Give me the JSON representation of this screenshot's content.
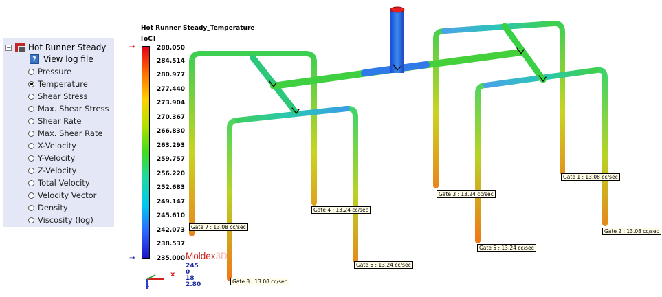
{
  "tree": {
    "root_label": "Hot Runner Steady",
    "log_label": "View log file",
    "options": [
      {
        "label": "Pressure",
        "selected": false
      },
      {
        "label": "Temperature",
        "selected": true
      },
      {
        "label": "Shear Stress",
        "selected": false
      },
      {
        "label": "Max. Shear Stress",
        "selected": false
      },
      {
        "label": "Shear Rate",
        "selected": false
      },
      {
        "label": "Max. Shear Rate",
        "selected": false
      },
      {
        "label": "X-Velocity",
        "selected": false
      },
      {
        "label": "Y-Velocity",
        "selected": false
      },
      {
        "label": "Z-Velocity",
        "selected": false
      },
      {
        "label": "Total Velocity",
        "selected": false
      },
      {
        "label": "Velocity Vector",
        "selected": false
      },
      {
        "label": "Density",
        "selected": false
      },
      {
        "label": "Viscosity (log)",
        "selected": false
      }
    ]
  },
  "legend": {
    "title": "Hot Runner Steady_Temperature",
    "unit": "[oC]",
    "ticks": [
      "288.050",
      "284.514",
      "280.977",
      "277.440",
      "273.904",
      "270.367",
      "266.830",
      "263.293",
      "259.757",
      "256.220",
      "252.683",
      "249.147",
      "245.610",
      "242.073",
      "238.537",
      "235.000"
    ],
    "colors": [
      "#e4001b",
      "#ff6a00",
      "#ffd000",
      "#b5e000",
      "#3fdc1e",
      "#20d8a2",
      "#00c8ee",
      "#2e63ff",
      "#1d14cc"
    ]
  },
  "brand": {
    "name": "Moldex",
    "suffix": "3D"
  },
  "view_info": [
    "245",
    "0",
    "18",
    "2.80"
  ],
  "axes": {
    "x": "x",
    "z": "z"
  },
  "gates": [
    {
      "label": "Gate 1 : 13.08 cc/sec"
    },
    {
      "label": "Gate 2 : 13.08 cc/sec"
    },
    {
      "label": "Gate 3 : 13.24 cc/sec"
    },
    {
      "label": "Gate 4 : 13.24 cc/sec"
    },
    {
      "label": "Gate 5 : 13.24 cc/sec"
    },
    {
      "label": "Gate 6 : 13.24 cc/sec"
    },
    {
      "label": "Gate 7 : 13.08 cc/sec"
    },
    {
      "label": "Gate 8 : 13.08 cc/sec"
    }
  ]
}
